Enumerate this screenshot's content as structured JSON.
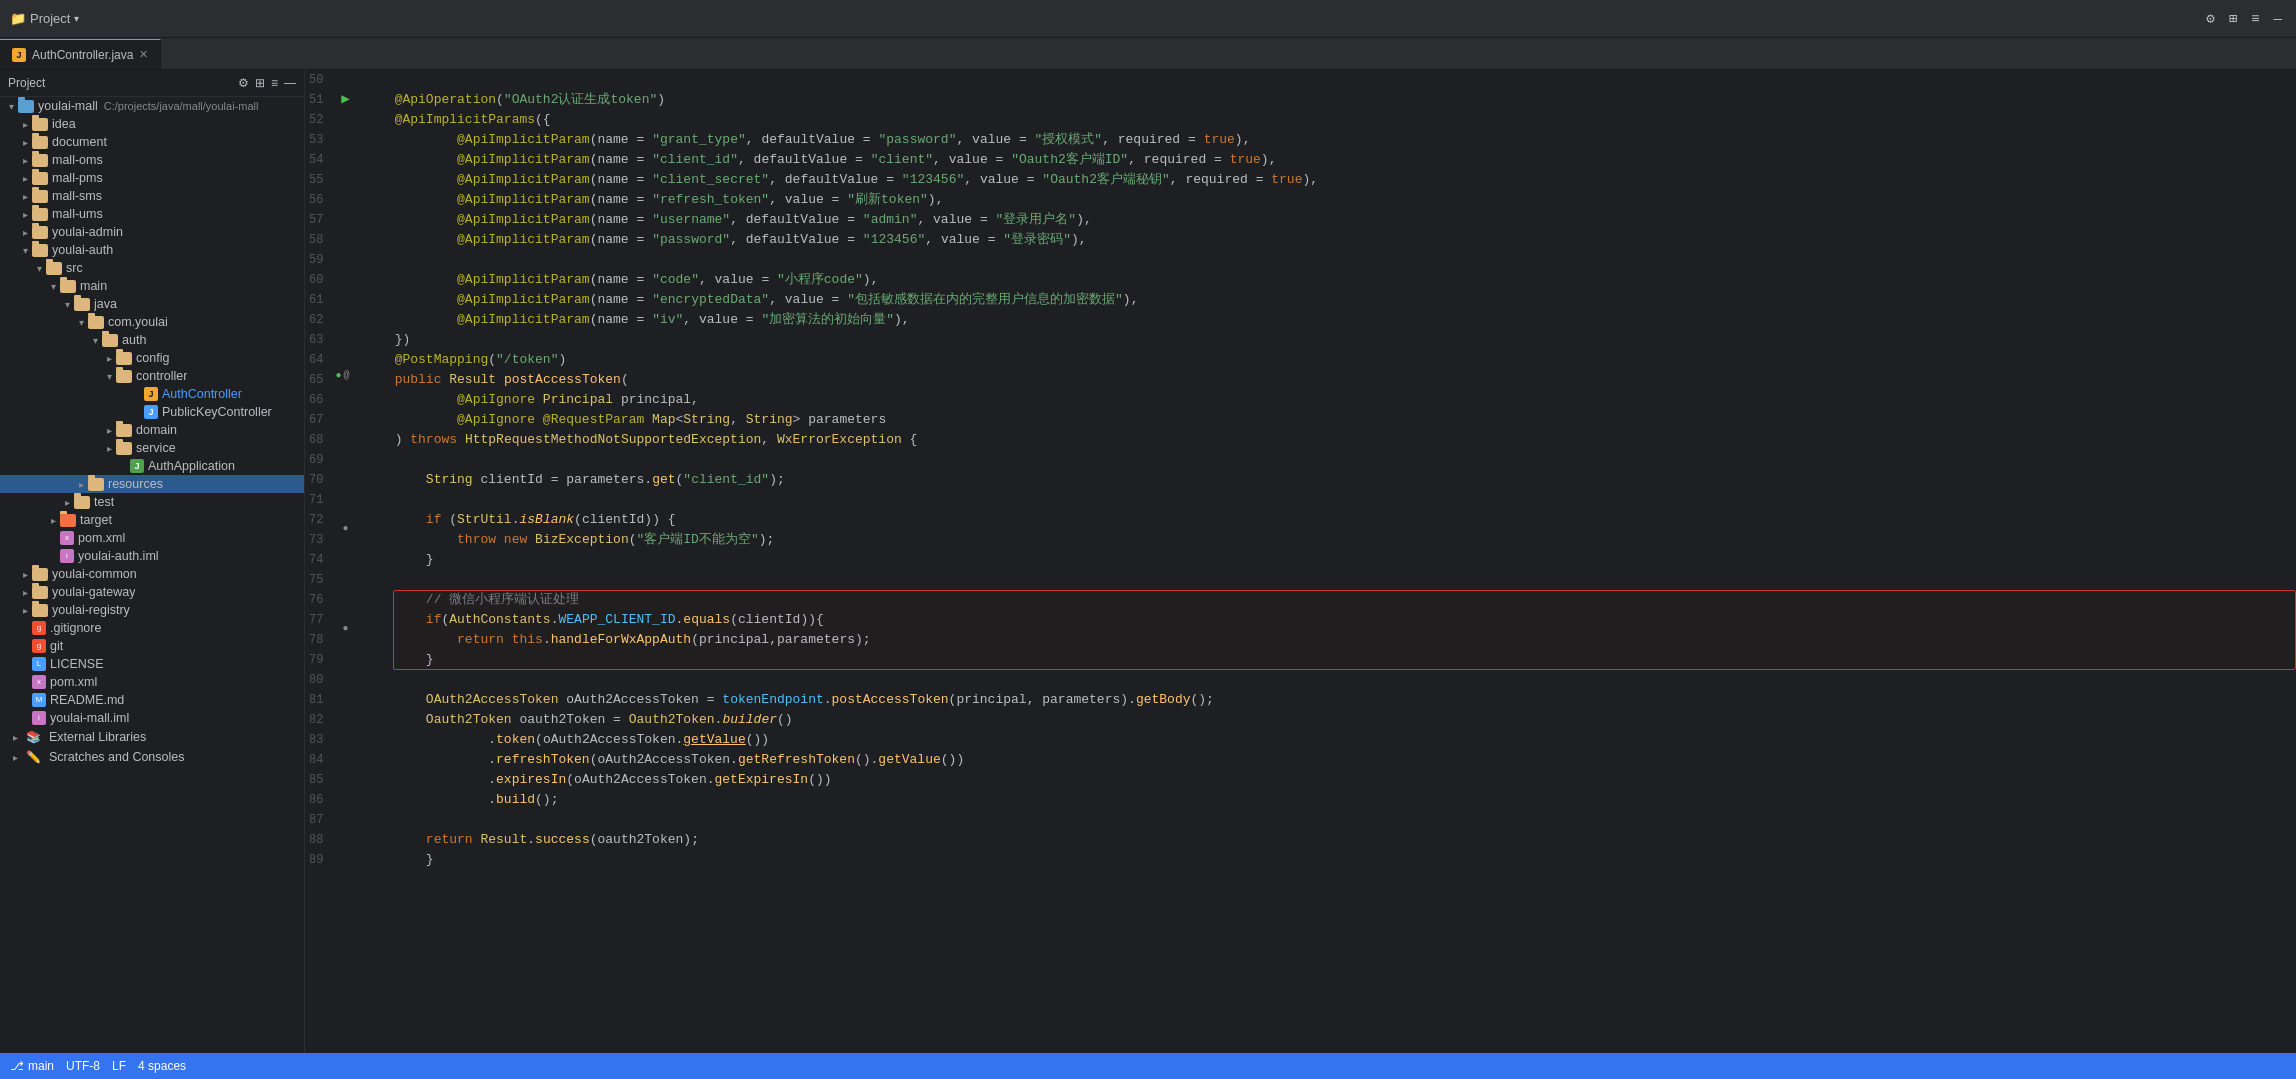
{
  "titleBar": {
    "projectLabel": "Project",
    "icons": [
      "⚙",
      "⊞",
      "≡",
      "—"
    ]
  },
  "tabs": [
    {
      "label": "AuthController.java",
      "active": true,
      "icon": "J"
    }
  ],
  "sidebar": {
    "header": {
      "title": "Project",
      "icons": [
        "⚙",
        "⊞"
      ]
    },
    "tree": [
      {
        "level": 0,
        "type": "folder",
        "label": "youlai-mall",
        "path": "C:/projects/java/mall/youlai-mall",
        "open": true,
        "color": "blue"
      },
      {
        "level": 1,
        "type": "folder",
        "label": "idea",
        "open": false,
        "color": "orange"
      },
      {
        "level": 1,
        "type": "folder",
        "label": "document",
        "open": false,
        "color": "orange"
      },
      {
        "level": 1,
        "type": "folder",
        "label": "mall-oms",
        "open": false,
        "color": "orange"
      },
      {
        "level": 1,
        "type": "folder",
        "label": "mall-pms",
        "open": false,
        "color": "orange"
      },
      {
        "level": 1,
        "type": "folder",
        "label": "mall-sms",
        "open": false,
        "color": "orange"
      },
      {
        "level": 1,
        "type": "folder",
        "label": "mall-ums",
        "open": false,
        "color": "orange"
      },
      {
        "level": 1,
        "type": "folder",
        "label": "youlai-admin",
        "open": false,
        "color": "orange"
      },
      {
        "level": 1,
        "type": "folder",
        "label": "youlai-auth",
        "open": true,
        "color": "orange"
      },
      {
        "level": 2,
        "type": "folder",
        "label": "src",
        "open": true,
        "color": "orange"
      },
      {
        "level": 3,
        "type": "folder",
        "label": "main",
        "open": true,
        "color": "orange"
      },
      {
        "level": 4,
        "type": "folder",
        "label": "java",
        "open": true,
        "color": "orange"
      },
      {
        "level": 5,
        "type": "folder",
        "label": "com.youlai",
        "open": true,
        "color": "orange"
      },
      {
        "level": 6,
        "type": "folder",
        "label": "auth",
        "open": true,
        "color": "orange"
      },
      {
        "level": 7,
        "type": "folder",
        "label": "config",
        "open": false,
        "color": "orange"
      },
      {
        "level": 7,
        "type": "folder",
        "label": "controller",
        "open": true,
        "color": "orange"
      },
      {
        "level": 8,
        "type": "file-java",
        "label": "AuthController",
        "color": "ctrl"
      },
      {
        "level": 8,
        "type": "file-java",
        "label": "PublicKeyController",
        "color": "blue"
      },
      {
        "level": 7,
        "type": "folder",
        "label": "domain",
        "open": false,
        "color": "orange"
      },
      {
        "level": 7,
        "type": "folder",
        "label": "service",
        "open": false,
        "color": "orange"
      },
      {
        "level": 8,
        "type": "file-java",
        "label": "AuthApplication",
        "color": "green"
      },
      {
        "level": 4,
        "type": "folder",
        "label": "resources",
        "open": false,
        "color": "orange",
        "selected": true
      },
      {
        "level": 3,
        "type": "folder",
        "label": "test",
        "open": false,
        "color": "orange"
      },
      {
        "level": 2,
        "type": "folder",
        "label": "target",
        "open": false,
        "color": "orange"
      },
      {
        "level": 2,
        "type": "file-xml",
        "label": "pom.xml"
      },
      {
        "level": 2,
        "type": "file-xml",
        "label": "youlai-auth.iml"
      },
      {
        "level": 1,
        "type": "folder",
        "label": "youlai-common",
        "open": false,
        "color": "orange"
      },
      {
        "level": 1,
        "type": "folder",
        "label": "youlai-gateway",
        "open": false,
        "color": "orange"
      },
      {
        "level": 1,
        "type": "folder",
        "label": "youlai-registry",
        "open": false,
        "color": "orange"
      },
      {
        "level": 1,
        "type": "file-git",
        "label": ".gitignore"
      },
      {
        "level": 1,
        "type": "file-git",
        "label": "git"
      },
      {
        "level": 1,
        "type": "file-txt",
        "label": "LICENSE"
      },
      {
        "level": 1,
        "type": "file-xml",
        "label": "pom.xml"
      },
      {
        "level": 1,
        "type": "file-md",
        "label": "README.md"
      },
      {
        "level": 1,
        "type": "file-xml",
        "label": "youlai-mall.iml"
      }
    ],
    "externalLibraries": "External Libraries",
    "scratchesAndConsoles": "Scratches and Consoles"
  },
  "editor": {
    "filename": "AuthController.java",
    "lines": [
      {
        "num": 50,
        "content": ""
      },
      {
        "num": 51,
        "content": "    @ApiOperation(\"OAuth2认证生成token\")",
        "gutter": "arrow"
      },
      {
        "num": 52,
        "content": "    @ApiImplicitParams({"
      },
      {
        "num": 53,
        "content": "            @ApiImplicitParam(name = \"grant_type\", defaultValue = \"password\", value = \"授权模式\", required = true),"
      },
      {
        "num": 54,
        "content": "            @ApiImplicitParam(name = \"client_id\", defaultValue = \"client\", value = \"Oauth2客户端ID\", required = true),"
      },
      {
        "num": 55,
        "content": "            @ApiImplicitParam(name = \"client_secret\", defaultValue = \"123456\", value = \"Oauth2客户端秘钥\", required = true),"
      },
      {
        "num": 56,
        "content": "            @ApiImplicitParam(name = \"refresh_token\", value = \"刷新token\"),"
      },
      {
        "num": 57,
        "content": "            @ApiImplicitParam(name = \"username\", defaultValue = \"admin\", value = \"登录用户名\"),"
      },
      {
        "num": 58,
        "content": "            @ApiImplicitParam(name = \"password\", defaultValue = \"123456\", value = \"登录密码\"),"
      },
      {
        "num": 59,
        "content": ""
      },
      {
        "num": 60,
        "content": "            @ApiImplicitParam(name = \"code\", value = \"小程序code\"),"
      },
      {
        "num": 61,
        "content": "            @ApiImplicitParam(name = \"encryptedData\", value = \"包括敏感数据在内的完整用户信息的加密数据\"),"
      },
      {
        "num": 62,
        "content": "            @ApiImplicitParam(name = \"iv\", value = \"加密算法的初始向量\"),"
      },
      {
        "num": 63,
        "content": "    })"
      },
      {
        "num": 64,
        "content": "    @PostMapping(\"/token\")"
      },
      {
        "num": 65,
        "content": "    public Result postAccessToken(",
        "gutter": "dots"
      },
      {
        "num": 66,
        "content": "            @ApiIgnore Principal principal,"
      },
      {
        "num": 67,
        "content": "            @ApiIgnore @RequestParam Map<String, String> parameters"
      },
      {
        "num": 68,
        "content": "    ) throws HttpRequestMethodNotSupportedException, WxErrorException {"
      },
      {
        "num": 69,
        "content": ""
      },
      {
        "num": 70,
        "content": "        String clientId = parameters.get(\"client_id\");"
      },
      {
        "num": 71,
        "content": ""
      },
      {
        "num": 72,
        "content": "        if (StrUtil.isBlank(clientId)) {"
      },
      {
        "num": 73,
        "content": "            throw new BizException(\"客户端ID不能为空\");"
      },
      {
        "num": 74,
        "content": "        }"
      },
      {
        "num": 75,
        "content": ""
      },
      {
        "num": 76,
        "content": "        // 微信小程序端认证处理",
        "highlight_box_start": true
      },
      {
        "num": 77,
        "content": "        if(AuthConstants.WEAPP_CLIENT_ID.equals(clientId)){"
      },
      {
        "num": 78,
        "content": "            return this.handleForWxAppAuth(principal,parameters);"
      },
      {
        "num": 79,
        "content": "        }",
        "highlight_box_end": true
      },
      {
        "num": 80,
        "content": ""
      },
      {
        "num": 81,
        "content": "        OAuth2AccessToken oAuth2AccessToken = tokenEndpoint.postAccessToken(principal, parameters).getBody();"
      },
      {
        "num": 82,
        "content": "        Oauth2Token oauth2Token = Oauth2Token.builder()"
      },
      {
        "num": 83,
        "content": "                .token(oAuth2AccessToken.getValue())"
      },
      {
        "num": 84,
        "content": "                .refreshToken(oAuth2AccessToken.getRefreshToken().getValue())"
      },
      {
        "num": 85,
        "content": "                .expiresIn(oAuth2AccessToken.getExpiresIn())"
      },
      {
        "num": 86,
        "content": "                .build();"
      },
      {
        "num": 87,
        "content": ""
      },
      {
        "num": 88,
        "content": "        return Result.success(oauth2Token);"
      },
      {
        "num": 89,
        "content": "        }"
      }
    ]
  },
  "bottomBar": {
    "branch": "main",
    "encoding": "UTF-8",
    "lineEnding": "LF",
    "indentation": "4 spaces"
  }
}
